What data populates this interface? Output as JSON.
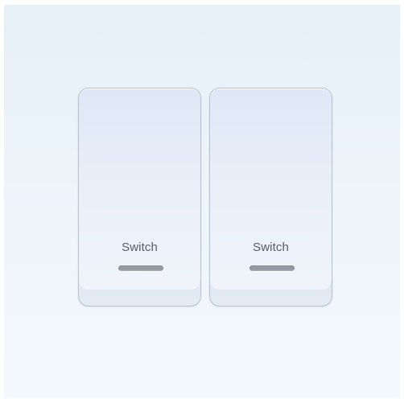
{
  "switches": [
    {
      "label": "Switch",
      "state": "off"
    },
    {
      "label": "Switch",
      "state": "off"
    }
  ],
  "colors": {
    "background": "#eef5fb",
    "button_face": "#e6edf8",
    "button_border": "#b9c3cf",
    "label_text": "#555d66",
    "indicator": "#979ca3"
  }
}
